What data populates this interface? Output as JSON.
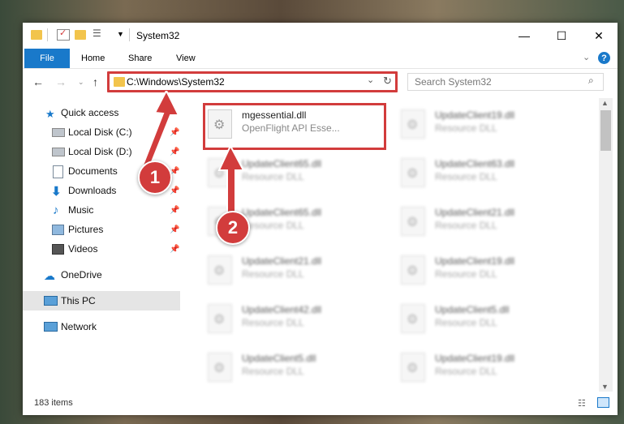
{
  "window": {
    "title": "System32"
  },
  "ribbon": {
    "tabs": [
      "File",
      "Home",
      "Share",
      "View"
    ]
  },
  "nav": {
    "address": "C:\\Windows\\System32",
    "search_placeholder": "Search System32"
  },
  "sidebar": {
    "quick_access": "Quick access",
    "items": [
      {
        "label": "Local Disk (C:)",
        "icon": "drive-icon"
      },
      {
        "label": "Local Disk (D:)",
        "icon": "drive-icon"
      },
      {
        "label": "Documents",
        "icon": "document-icon"
      },
      {
        "label": "Downloads",
        "icon": "download-icon"
      },
      {
        "label": "Music",
        "icon": "music-icon"
      },
      {
        "label": "Pictures",
        "icon": "picture-icon"
      },
      {
        "label": "Videos",
        "icon": "video-icon"
      }
    ],
    "onedrive": "OneDrive",
    "this_pc": "This PC",
    "network": "Network"
  },
  "files": [
    {
      "name": "mgessential.dll",
      "desc": "OpenFlight API Esse..."
    },
    {
      "name": "UpdateClient19.dll",
      "desc": "Resource DLL"
    },
    {
      "name": "UpdateClient65.dll",
      "desc": "Resource DLL"
    },
    {
      "name": "UpdateClient63.dll",
      "desc": "Resource DLL"
    },
    {
      "name": "UpdateClient65.dll",
      "desc": "Resource DLL"
    },
    {
      "name": "UpdateClient21.dll",
      "desc": "Resource DLL"
    },
    {
      "name": "UpdateClient21.dll",
      "desc": "Resource DLL"
    },
    {
      "name": "UpdateClient19.dll",
      "desc": "Resource DLL"
    },
    {
      "name": "UpdateClient42.dll",
      "desc": "Resource DLL"
    },
    {
      "name": "UpdateClient5.dll",
      "desc": "Resource DLL"
    },
    {
      "name": "UpdateClient5.dll",
      "desc": "Resource DLL"
    },
    {
      "name": "UpdateClient19.dll",
      "desc": "Resource DLL"
    }
  ],
  "status": {
    "items": "183 items"
  },
  "annotations": {
    "step1": "1",
    "step2": "2"
  },
  "colors": {
    "accent": "#1979ca",
    "highlight": "#d23c3c"
  }
}
